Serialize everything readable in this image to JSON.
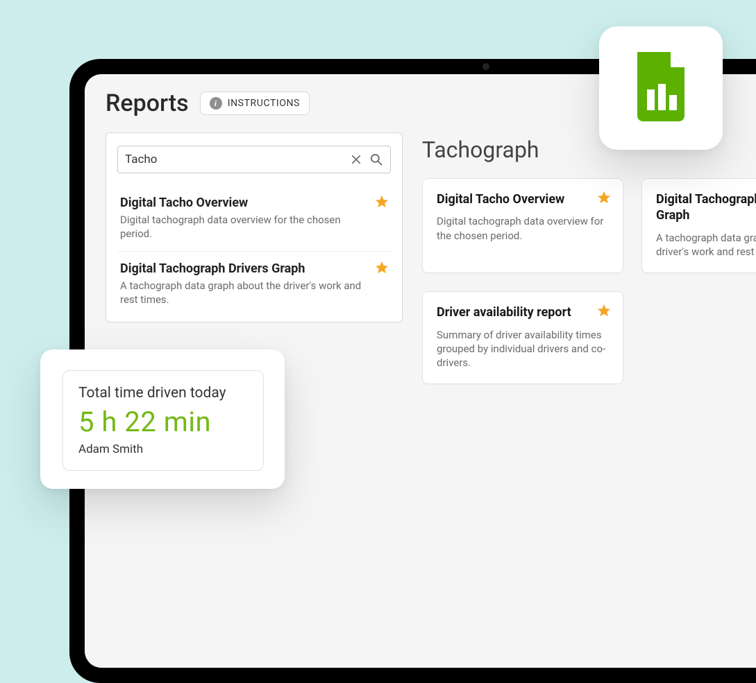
{
  "header": {
    "title": "Reports",
    "instructions_label": "INSTRUCTIONS"
  },
  "search": {
    "value": "Tacho",
    "results": [
      {
        "title": "Digital Tacho Overview",
        "desc": "Digital tachograph data overview for the chosen period.",
        "favorited": true
      },
      {
        "title": "Digital Tachograph Drivers Graph",
        "desc": "A tachograph data graph about the driver's work and rest times.",
        "favorited": true
      }
    ]
  },
  "section": {
    "title": "Tachograph",
    "cards": [
      {
        "title": "Digital Tacho Overview",
        "desc": "Digital tachograph data overview for the chosen period.",
        "favorited": true
      },
      {
        "title": "Digital Tachograph Drivers Graph",
        "desc": "A tachograph data graph about the driver's work and rest times.",
        "favorited": true
      },
      {
        "title": "Driver availability report",
        "desc": "Summary of driver availability times grouped by individual drivers and co-drivers.",
        "favorited": true
      }
    ]
  },
  "stat": {
    "label": "Total time driven today",
    "value": "5 h  22 min",
    "driver": "Adam Smith"
  },
  "colors": {
    "accent_green": "#74b816",
    "star": "#f5a623"
  }
}
